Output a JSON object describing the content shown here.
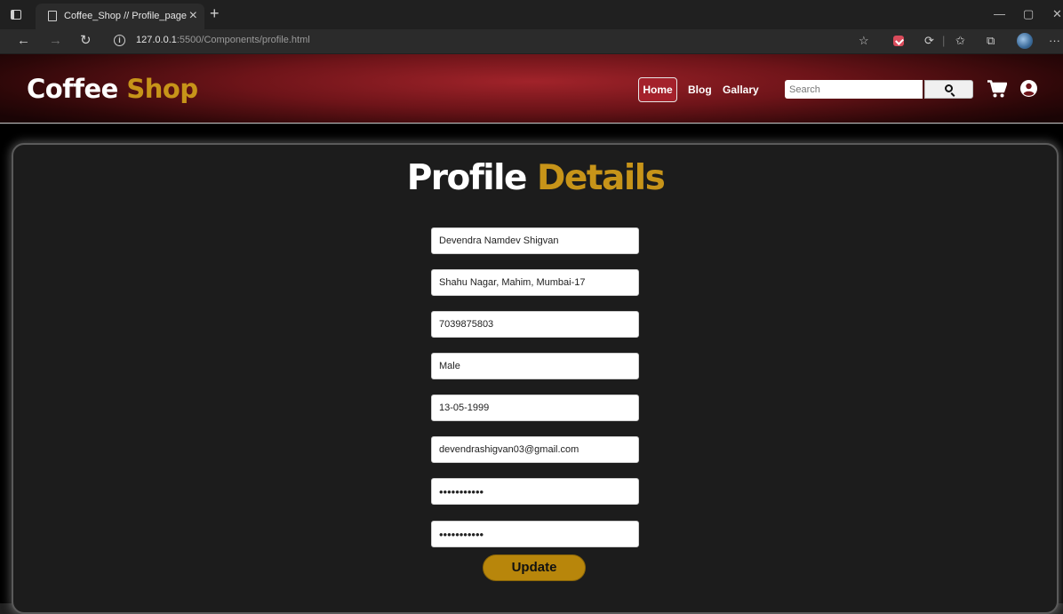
{
  "browser": {
    "tab_title": "Coffee_Shop // Profile_page",
    "tab_close": "×",
    "new_tab": "+",
    "url_host": "127.0.0.1",
    "url_path": ":5500/Components/profile.html",
    "window_controls": [
      "—",
      "▢",
      "✕"
    ]
  },
  "header": {
    "brand_part1": "Coffee",
    "brand_part2": "Shop",
    "nav": [
      {
        "label": "Home",
        "active": true
      },
      {
        "label": "Blog",
        "active": false
      },
      {
        "label": "Gallary",
        "active": false
      }
    ],
    "search": {
      "placeholder": "Search",
      "value": ""
    },
    "icons": [
      "search-icon",
      "cart-icon",
      "user-icon"
    ]
  },
  "profile": {
    "title_part1": "Profile",
    "title_part2": "Details",
    "fields": [
      {
        "name": "full-name",
        "value": "Devendra Namdev Shigvan"
      },
      {
        "name": "address",
        "value": "Shahu Nagar, Mahim, Mumbai-17"
      },
      {
        "name": "phone",
        "value": "7039875803"
      },
      {
        "name": "gender",
        "value": "Male"
      },
      {
        "name": "dob",
        "value": "13-05-1999"
      },
      {
        "name": "email",
        "value": "devendrashigvan03@gmail.com"
      },
      {
        "name": "password",
        "value": "•••••••••••"
      },
      {
        "name": "confirm-password",
        "value": "•••••••••••"
      }
    ],
    "update_label": "Update"
  },
  "colors": {
    "accent": "#c79419",
    "header_red": "#a1232a",
    "button_gold": "#b8860b",
    "panel_bg": "#1c1c1c"
  }
}
